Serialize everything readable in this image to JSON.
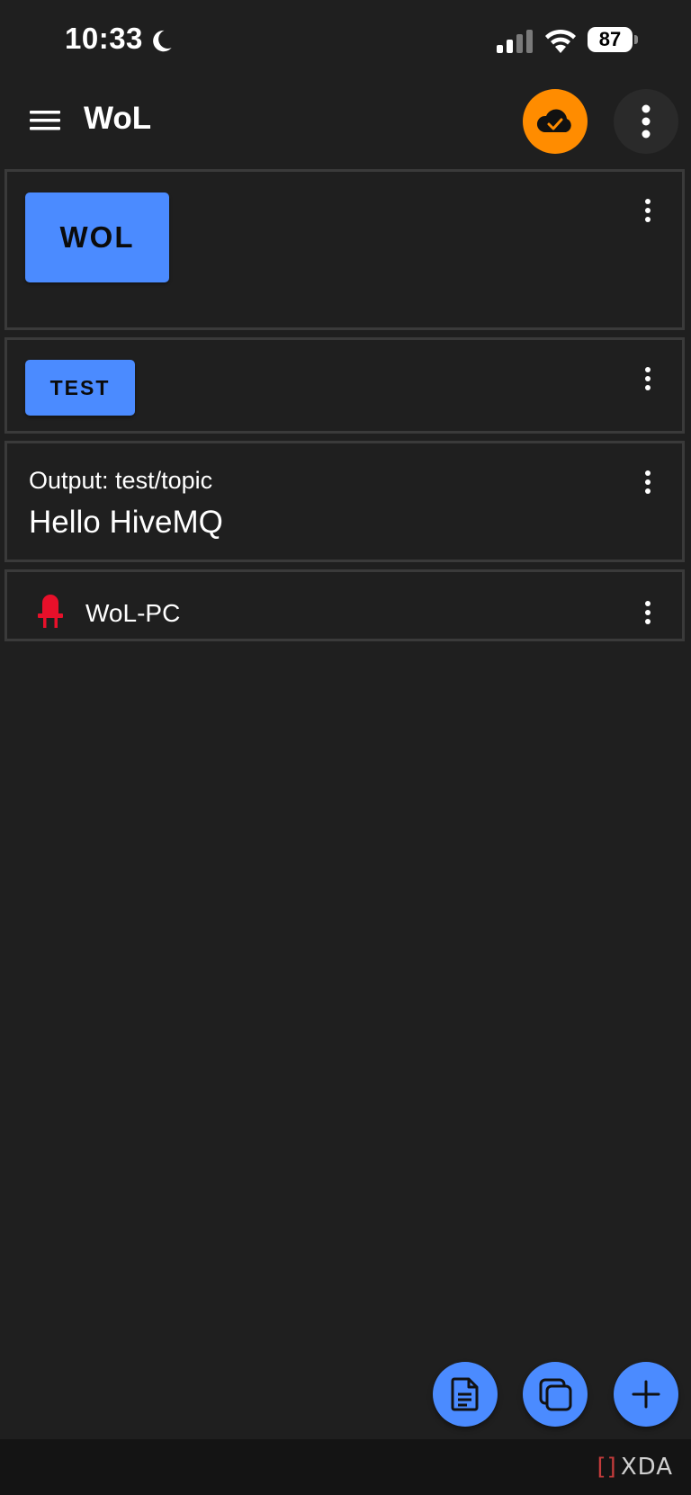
{
  "status_bar": {
    "time": "10:33",
    "battery": "87"
  },
  "app_bar": {
    "title": "WoL"
  },
  "cards": {
    "wol": {
      "button_label": "WOL"
    },
    "test": {
      "button_label": "TEST"
    },
    "output": {
      "label": "Output: test/topic",
      "value": "Hello HiveMQ"
    },
    "device": {
      "label": "WoL-PC",
      "led_color": "#e8102a"
    }
  },
  "icons": {
    "menu": "hamburger-menu-icon",
    "cloud": "cloud-check-icon",
    "overflow": "more-vert-icon",
    "fab_1": "document-icon",
    "fab_2": "copy-icon",
    "fab_3": "plus-icon"
  },
  "colors": {
    "accent": "#4b8bff",
    "cloud_status": "#ff8c00",
    "background": "#1f1f1f"
  },
  "watermark": "XDA"
}
